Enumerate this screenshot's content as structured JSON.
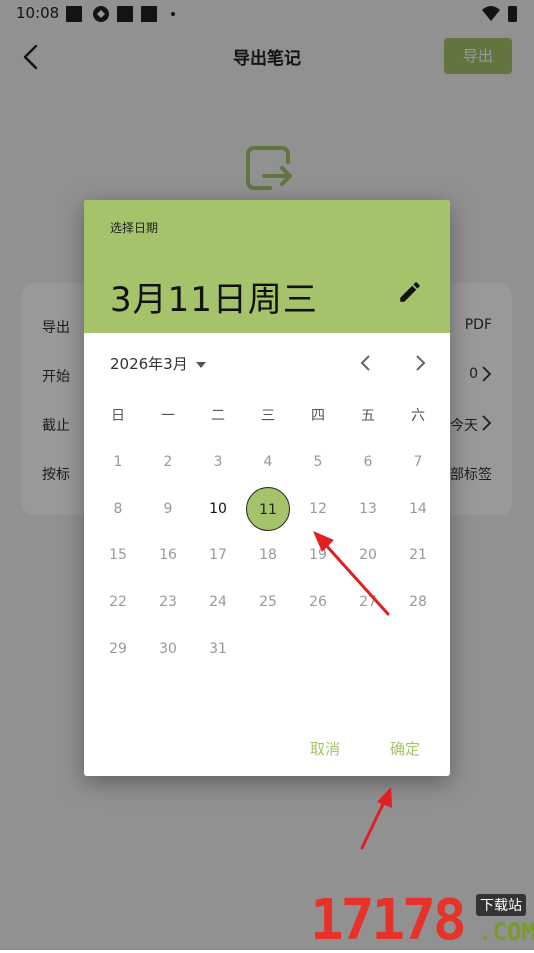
{
  "status_bar": {
    "time": "10:08"
  },
  "header": {
    "title": "导出笔记",
    "export_label": "导出"
  },
  "settings": {
    "rows": [
      {
        "label": "导出",
        "value": "PDF"
      },
      {
        "label": "开始",
        "value": "0"
      },
      {
        "label": "截止",
        "value": "今天"
      },
      {
        "label": "按标",
        "value": "部标签"
      }
    ]
  },
  "dialog": {
    "subtitle": "选择日期",
    "selected_date_text": "3月11日周三",
    "month_label": "2026年3月",
    "weekdays": [
      "日",
      "一",
      "二",
      "三",
      "四",
      "五",
      "六"
    ],
    "weeks": [
      [
        "1",
        "2",
        "3",
        "4",
        "5",
        "6",
        "7"
      ],
      [
        "8",
        "9",
        "10",
        "11",
        "12",
        "13",
        "14"
      ],
      [
        "15",
        "16",
        "17",
        "18",
        "19",
        "20",
        "21"
      ],
      [
        "22",
        "23",
        "24",
        "25",
        "26",
        "27",
        "28"
      ],
      [
        "29",
        "30",
        "31",
        "",
        "",
        "",
        ""
      ]
    ],
    "today_day": "10",
    "selected_day": "11",
    "cancel_label": "取消",
    "ok_label": "确定"
  },
  "watermark": {
    "number": "17178",
    "tag": "下载站",
    "suffix": ".COM"
  },
  "colors": {
    "accent": "#a5c36a",
    "arrow": "#e02020"
  }
}
